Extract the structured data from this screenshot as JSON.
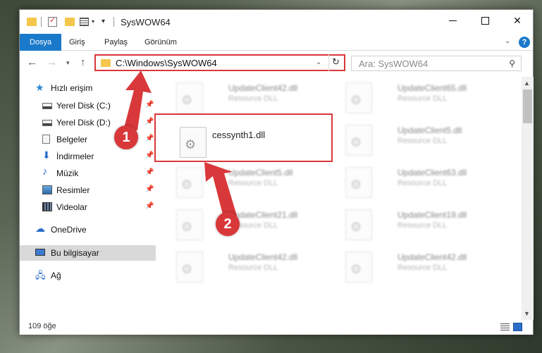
{
  "window": {
    "title": "SysWOW64",
    "controls": {
      "minimize": "minimize",
      "maximize": "maximize",
      "close": "✕"
    }
  },
  "ribbon": {
    "tabs": [
      {
        "label": "Dosya",
        "active": true
      },
      {
        "label": "Giriş"
      },
      {
        "label": "Paylaş"
      },
      {
        "label": "Görünüm"
      }
    ],
    "help": "?"
  },
  "nav": {
    "address": "C:\\Windows\\SysWOW64",
    "search_placeholder": "Ara: SysWOW64"
  },
  "sidebar": {
    "quick_access": "Hızlı erişim",
    "items": [
      {
        "label": "Yerel Disk (C:)",
        "icon": "drive-icon",
        "pinned": true
      },
      {
        "label": "Yerel Disk (D:)",
        "icon": "drive-icon",
        "pinned": true
      },
      {
        "label": "Belgeler",
        "icon": "documents-icon",
        "pinned": true
      },
      {
        "label": "İndirmeler",
        "icon": "downloads-icon",
        "pinned": true
      },
      {
        "label": "Müzik",
        "icon": "music-icon",
        "pinned": true
      },
      {
        "label": "Resimler",
        "icon": "pictures-icon",
        "pinned": true
      },
      {
        "label": "Videolar",
        "icon": "videos-icon",
        "pinned": true
      }
    ],
    "onedrive": "OneDrive",
    "this_pc": "Bu bilgisayar",
    "network": "Ağ"
  },
  "files": [
    {
      "name": "UpdateClient42.dll",
      "type": "Resource DLL",
      "blurred": true
    },
    {
      "name": "UpdateClient65.dll",
      "type": "Resource DLL",
      "blurred": true
    },
    {
      "name": "cessynth1.dll",
      "type": "",
      "blurred": false
    },
    {
      "name": "UpdateClient5.dll",
      "type": "Resource DLL",
      "blurred": true
    },
    {
      "name": "UpdateClient5.dll",
      "type": "Resource DLL",
      "blurred": true
    },
    {
      "name": "UpdateClient63.dll",
      "type": "Resource DLL",
      "blurred": true
    },
    {
      "name": "UpdateClient21.dll",
      "type": "Resource DLL",
      "blurred": true
    },
    {
      "name": "UpdateClient19.dll",
      "type": "Resource DLL",
      "blurred": true
    },
    {
      "name": "UpdateClient42.dll",
      "type": "Resource DLL",
      "blurred": true
    },
    {
      "name": "UpdateClient42.dll",
      "type": "Resource DLL",
      "blurred": true
    }
  ],
  "status": {
    "item_count": "109 öğe"
  },
  "annotations": {
    "marker1": "1",
    "marker2": "2",
    "color": "#d9383a"
  }
}
